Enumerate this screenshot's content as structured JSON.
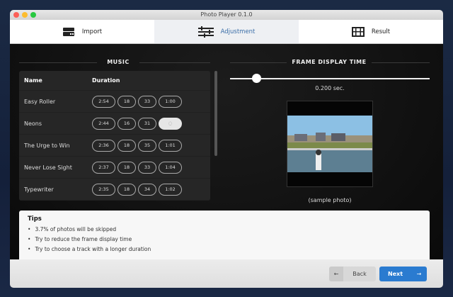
{
  "window": {
    "title": "Photo Player 0.1.0"
  },
  "steps": [
    {
      "label": "Import",
      "icon": "drive-icon"
    },
    {
      "label": "Adjustment",
      "icon": "sliders-icon"
    },
    {
      "label": "Result",
      "icon": "film-icon"
    }
  ],
  "music": {
    "title": "MUSIC",
    "headers": {
      "name": "Name",
      "duration": "Duration"
    },
    "tracks": [
      {
        "name": "Easy Roller",
        "d": [
          "2:54",
          "18",
          "33",
          "1:00"
        ]
      },
      {
        "name": "Neons",
        "d": [
          "2:44",
          "16",
          "31",
          ""
        ]
      },
      {
        "name": "The Urge to Win",
        "d": [
          "2:36",
          "18",
          "35",
          "1:01"
        ]
      },
      {
        "name": "Never Lose Sight",
        "d": [
          "2:37",
          "18",
          "33",
          "1:04"
        ]
      },
      {
        "name": "Typewriter",
        "d": [
          "2:35",
          "18",
          "34",
          "1:02"
        ]
      }
    ]
  },
  "frame": {
    "title": "FRAME DISPLAY TIME",
    "value": "0.200 sec.",
    "slider_fraction": 0.13,
    "caption": "(sample photo)"
  },
  "tips": {
    "title": "Tips",
    "items": [
      "3.7% of photos will be skipped",
      "Try to reduce the frame display time",
      "Try to choose a track with a longer duration"
    ]
  },
  "footer": {
    "back": "Back",
    "next": "Next"
  },
  "colors": {
    "accent": "#2a7bd0"
  }
}
